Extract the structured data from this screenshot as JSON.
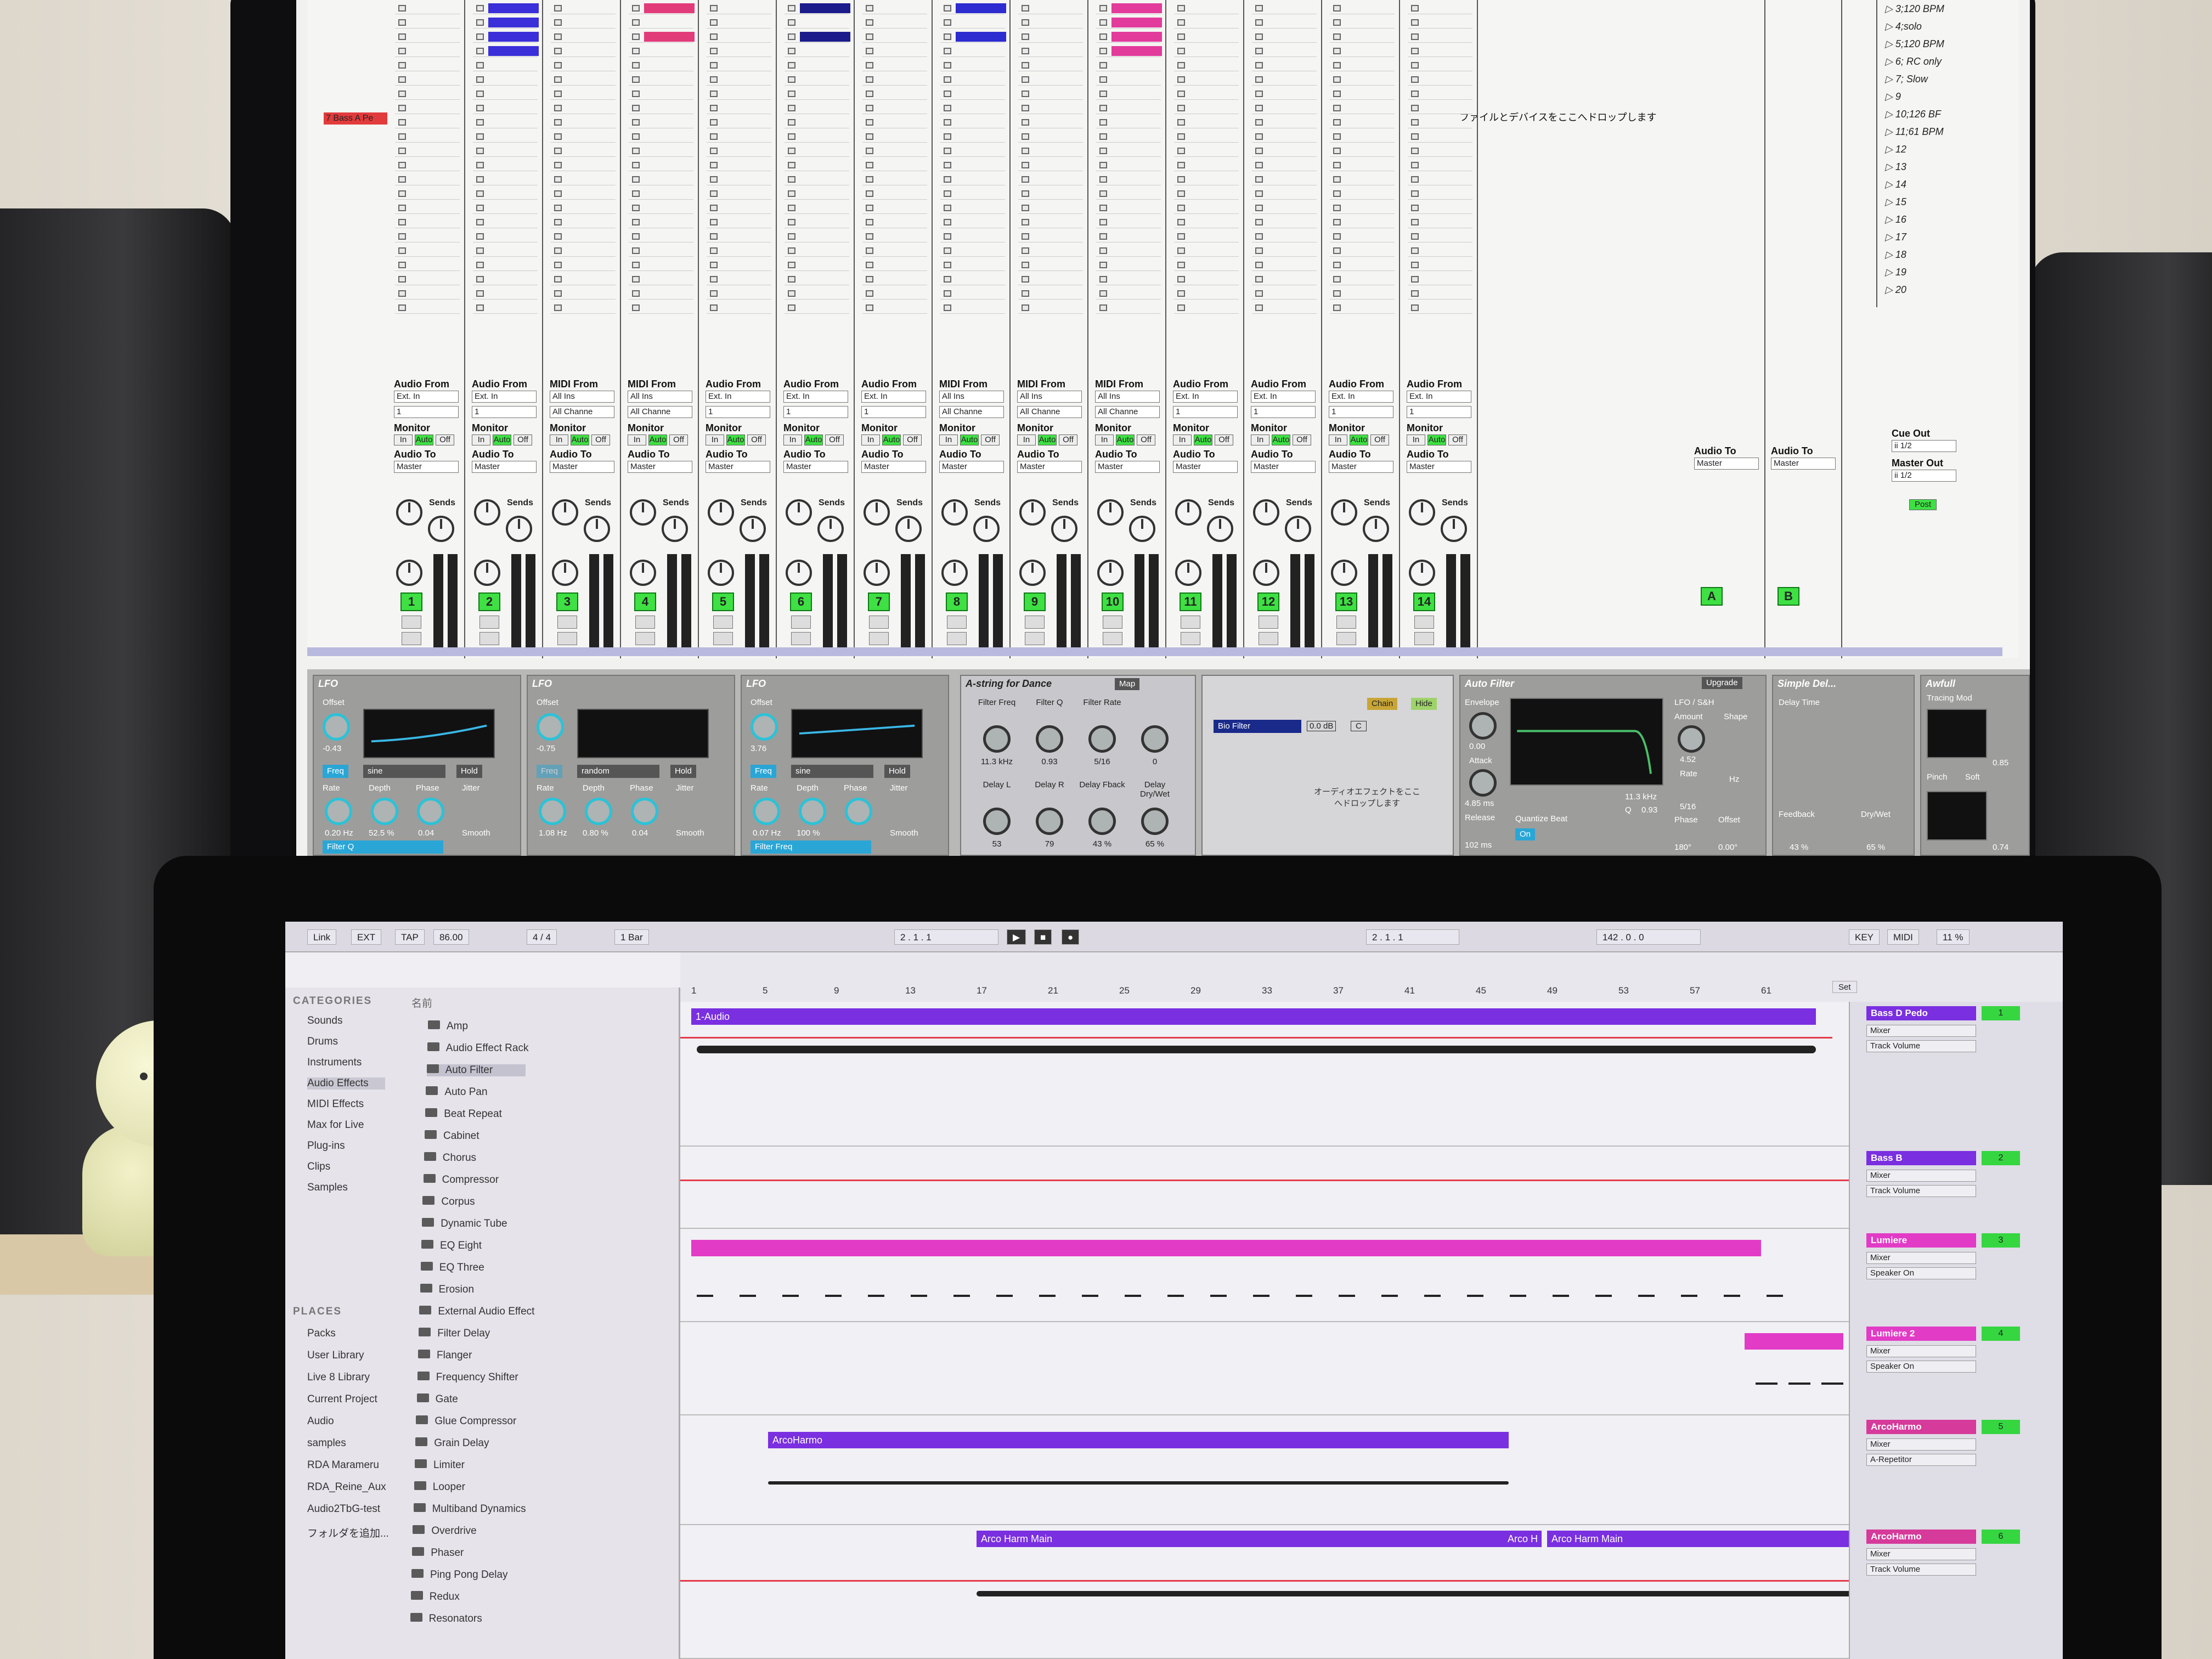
{
  "monitor": {
    "session_drop_text": "ファイルとデバイスをここへドロップします",
    "red_clip_label": "7 Bass A Pe",
    "scenes": [
      "3;120 BPM",
      "4;solo",
      "5;120 BPM",
      "6; RC only",
      "7; Slow",
      "9",
      "10;126 BF",
      "11;61 BPM",
      "12",
      "13",
      "14",
      "15",
      "16",
      "17",
      "18",
      "19",
      "20"
    ],
    "tracks": [
      {
        "from_label": "Audio From",
        "from": "Ext. In",
        "ch": "1",
        "num": "1"
      },
      {
        "from_label": "Audio From",
        "from": "Ext. In",
        "ch": "1",
        "num": "2"
      },
      {
        "from_label": "MIDI From",
        "from": "All Ins",
        "ch": "All Channe",
        "num": "3"
      },
      {
        "from_label": "MIDI From",
        "from": "All Ins",
        "ch": "All Channe",
        "num": "4"
      },
      {
        "from_label": "Audio From",
        "from": "Ext. In",
        "ch": "1",
        "num": "5"
      },
      {
        "from_label": "Audio From",
        "from": "Ext. In",
        "ch": "1",
        "num": "6"
      },
      {
        "from_label": "Audio From",
        "from": "Ext. In",
        "ch": "1",
        "num": "7"
      },
      {
        "from_label": "MIDI From",
        "from": "All Ins",
        "ch": "All Channe",
        "num": "8"
      },
      {
        "from_label": "MIDI From",
        "from": "All Ins",
        "ch": "All Channe",
        "num": "9"
      },
      {
        "from_label": "MIDI From",
        "from": "All Ins",
        "ch": "All Channe",
        "num": "10"
      },
      {
        "from_label": "Audio From",
        "from": "Ext. In",
        "ch": "1",
        "num": "11"
      },
      {
        "from_label": "Audio From",
        "from": "Ext. In",
        "ch": "1",
        "num": "12"
      },
      {
        "from_label": "Audio From",
        "from": "Ext. In",
        "ch": "1",
        "num": "13"
      },
      {
        "from_label": "Audio From",
        "from": "Ext. In",
        "ch": "1",
        "num": "14"
      }
    ],
    "monitor_label": "Monitor",
    "mon_in": "In",
    "mon_auto": "Auto",
    "mon_off": "Off",
    "audio_to_label": "Audio To",
    "audio_to": "Master",
    "sends_label": "Sends",
    "return_a": "A",
    "return_b": "B",
    "cue_out_label": "Cue Out",
    "cue_out": "ii 1/2",
    "master_out_label": "Master Out",
    "master_out": "ii 1/2",
    "post_label": "Post",
    "devices": {
      "lfo_title": "LFO",
      "offset_label": "Offset",
      "lfo1": {
        "offset": "-0.43",
        "freq": "Freq",
        "shape": "sine",
        "hold": "Hold",
        "rate": "0.20 Hz",
        "depth": "52.5 %",
        "phase": "0.04",
        "target": "Filter Q"
      },
      "lfo2": {
        "offset": "-0.75",
        "freq": "Freq",
        "shape": "random",
        "hold": "Hold",
        "rate": "1.08 Hz",
        "depth": "0.80 %",
        "phase": "0.04"
      },
      "lfo3": {
        "offset": "3.76",
        "freq": "Freq",
        "shape": "sine",
        "hold": "Hold",
        "rate": "0.07 Hz",
        "depth": "100 %",
        "target": "Filter Freq"
      },
      "rate_label": "Rate",
      "depth_label": "Depth",
      "phase_label": "Phase",
      "jitter_label": "Jitter",
      "smooth_label": "Smooth",
      "rack_title": "A-string for Dance",
      "rack_map": "Map",
      "rack_macros": [
        {
          "label": "Filter Freq",
          "value": "11.3 kHz"
        },
        {
          "label": "Filter Q",
          "value": "0.93"
        },
        {
          "label": "Filter Rate",
          "value": "5/16"
        },
        {
          "label": "",
          "value": "0"
        },
        {
          "label": "Delay L",
          "value": "53"
        },
        {
          "label": "Delay R",
          "value": "79"
        },
        {
          "label": "Delay Fback",
          "value": "43 %"
        },
        {
          "label": "Delay Dry/Wet",
          "value": "65 %"
        }
      ],
      "chain_label": "Chain",
      "hide_label": "Hide",
      "chain_name": "Bio Filter",
      "chain_vol": "0.0 dB",
      "chain_pan": "C",
      "chain_drop_text": "オーディオエフェクトをここへドロップします",
      "autofilter_title": "Auto Filter",
      "upgrade_label": "Upgrade",
      "envelope_label": "Envelope",
      "env_value": "0.00",
      "attack_label": "Attack",
      "attack_value": "4.85 ms",
      "release_label": "Release",
      "release_value": "102 ms",
      "quantize_label": "Quantize Beat",
      "on_label": "On",
      "freq_value": "11.3 kHz",
      "q_label": "Q",
      "q_value": "0.93",
      "lfo_sh_label": "LFO / S&H",
      "amount_label": "Amount",
      "shape_label": "Shape",
      "amount_value": "4.52",
      "rate2_value": "5/16",
      "phase2_value": "180°",
      "offset2_label": "Offset",
      "offset2_value": "0.00°",
      "hz_label": "Hz",
      "simple_delay_title": "Simple Del...",
      "delay_time_label": "Delay Time",
      "feedback_label": "Feedback",
      "feedback_value": "43 %",
      "drywet_label": "Dry/Wet",
      "drywet_value": "65 %",
      "awfull_title": "Awfull",
      "tracing_label": "Tracing Mod",
      "pinch_label": "Pinch",
      "soft_label": "Soft",
      "val_085": "0.85",
      "val_074": "0.74"
    }
  },
  "laptop": {
    "transport": {
      "link": "Link",
      "ext": "EXT",
      "tap": "TAP",
      "tempo": "86.00",
      "signature": "4 / 4",
      "quant": "1 Bar",
      "position": "2 . 1 . 1",
      "loop_start": "2 . 1 . 1",
      "loop_len": "142 . 0 . 0",
      "key": "KEY",
      "midi": "MIDI",
      "cpu": "11 %"
    },
    "categories_head": "CATEGORIES",
    "categories": [
      "Sounds",
      "Drums",
      "Instruments",
      "Audio Effects",
      "MIDI Effects",
      "Max for Live",
      "Plug-ins",
      "Clips",
      "Samples"
    ],
    "places_head": "PLACES",
    "places": [
      "Packs",
      "User Library",
      "Live 8 Library",
      "Current Project",
      "Audio",
      "samples",
      "RDA Marameru",
      "RDA_Reine_Aux",
      "Audio2TbG-test",
      "フォルダを追加..."
    ],
    "name_col": "名前",
    "files": [
      "Amp",
      "Audio Effect Rack",
      "Auto Filter",
      "Auto Pan",
      "Beat Repeat",
      "Cabinet",
      "Chorus",
      "Compressor",
      "Corpus",
      "Dynamic Tube",
      "EQ Eight",
      "EQ Three",
      "Erosion",
      "External Audio Effect",
      "Filter Delay",
      "Flanger",
      "Frequency Shifter",
      "Gate",
      "Glue Compressor",
      "Grain Delay",
      "Limiter",
      "Looper",
      "Multiband Dynamics",
      "Overdrive",
      "Phaser",
      "Ping Pong Delay",
      "Redux",
      "Resonators"
    ],
    "bars": [
      "1",
      "5",
      "9",
      "13",
      "17",
      "21",
      "25",
      "29",
      "33",
      "37",
      "41",
      "45",
      "49",
      "53",
      "57",
      "61"
    ],
    "set_label": "Set",
    "lanes": [
      {
        "clip": "1-Audio",
        "track": "Bass D Pedo",
        "num": "1",
        "d1": "Mixer",
        "d2": "Track Volume"
      },
      {
        "clip": "",
        "track": "Bass B",
        "num": "2",
        "d1": "Mixer",
        "d2": "Track Volume"
      },
      {
        "clip": "",
        "track": "Lumiere",
        "num": "3",
        "d1": "Mixer",
        "d2": "Speaker On"
      },
      {
        "clip": "",
        "track": "Lumiere 2",
        "num": "4",
        "d1": "Mixer",
        "d2": "Speaker On"
      },
      {
        "clip": "ArcoHarmo",
        "track": "ArcoHarmo",
        "num": "5",
        "d1": "Mixer",
        "d2": "A-Repetitor"
      },
      {
        "clip": "Arco Harm Main",
        "clip_b": "Arco H",
        "clip_c": "Arco Harm Main",
        "track": "ArcoHarmo",
        "num": "6",
        "d1": "Mixer",
        "d2": "Track Volume"
      }
    ]
  }
}
